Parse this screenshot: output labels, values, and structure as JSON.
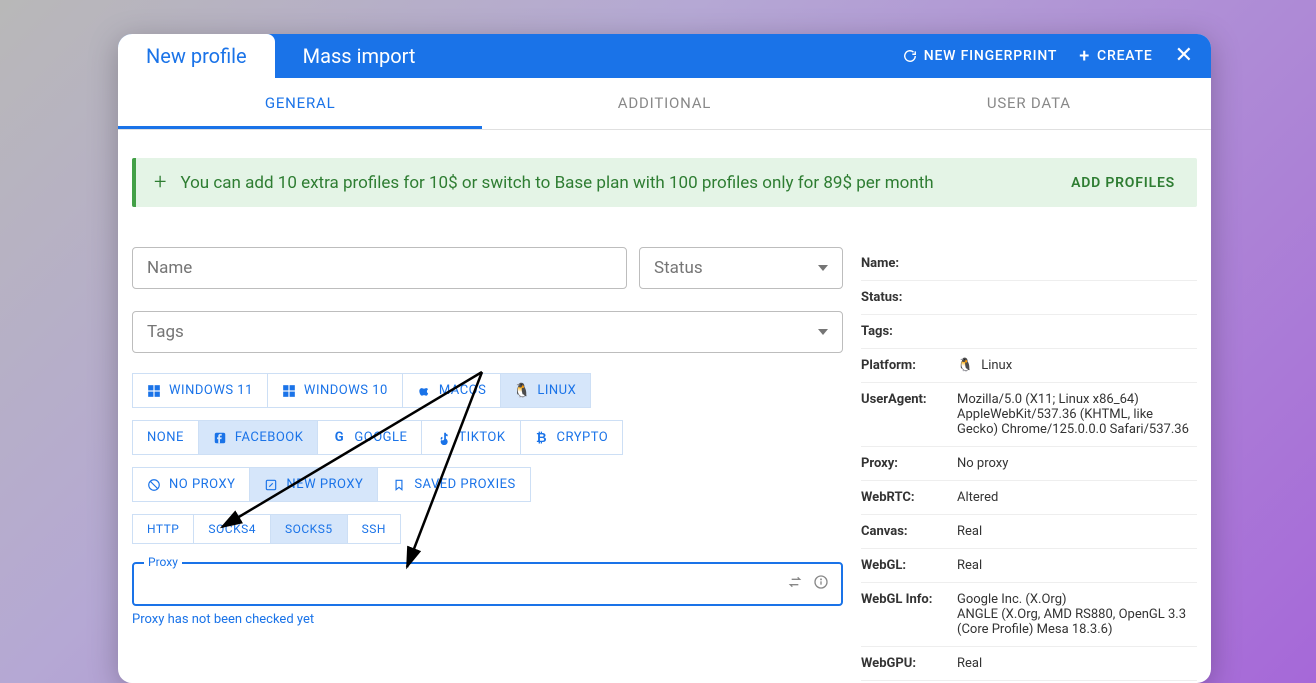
{
  "topbar": {
    "tabs": [
      {
        "label": "New profile",
        "active": true
      },
      {
        "label": "Mass import",
        "active": false
      }
    ],
    "new_fingerprint": "NEW FINGERPRINT",
    "create": "CREATE"
  },
  "subtabs": [
    {
      "label": "GENERAL",
      "active": true
    },
    {
      "label": "ADDITIONAL",
      "active": false
    },
    {
      "label": "USER DATA",
      "active": false
    }
  ],
  "banner": {
    "text": "You can add 10 extra profiles for 10$ or switch to Base plan with 100 profiles only for 89$ per month",
    "action": "ADD PROFILES"
  },
  "form": {
    "name_placeholder": "Name",
    "status_placeholder": "Status",
    "tags_placeholder": "Tags"
  },
  "os_chips": [
    {
      "label": "WINDOWS 11",
      "icon": "windows",
      "active": false
    },
    {
      "label": "WINDOWS 10",
      "icon": "windows",
      "active": false
    },
    {
      "label": "MACOS",
      "icon": "apple",
      "active": false
    },
    {
      "label": "LINUX",
      "icon": "linux",
      "active": true
    }
  ],
  "site_chips": [
    {
      "label": "NONE",
      "icon": "",
      "active": false
    },
    {
      "label": "FACEBOOK",
      "icon": "facebook",
      "active": true
    },
    {
      "label": "GOOGLE",
      "icon": "google",
      "active": false
    },
    {
      "label": "TIKTOK",
      "icon": "tiktok",
      "active": false
    },
    {
      "label": "CRYPTO",
      "icon": "crypto",
      "active": false
    }
  ],
  "proxy_mode_chips": [
    {
      "label": "NO PROXY",
      "icon": "noproxy",
      "active": false
    },
    {
      "label": "NEW PROXY",
      "icon": "edit",
      "active": true
    },
    {
      "label": "SAVED PROXIES",
      "icon": "bookmark",
      "active": false
    }
  ],
  "proto_chips": [
    {
      "label": "HTTP",
      "active": false
    },
    {
      "label": "SOCKS4",
      "active": false
    },
    {
      "label": "SOCKS5",
      "active": true
    },
    {
      "label": "SSH",
      "active": false
    }
  ],
  "proxy": {
    "label": "Proxy",
    "hint": "Proxy has not been checked yet"
  },
  "info": {
    "rows": [
      {
        "label": "Name:",
        "value": ""
      },
      {
        "label": "Status:",
        "value": ""
      },
      {
        "label": "Tags:",
        "value": ""
      },
      {
        "label": "Platform:",
        "value": "Linux",
        "icon": "linux"
      },
      {
        "label": "UserAgent:",
        "value": "Mozilla/5.0 (X11; Linux x86_64) AppleWebKit/537.36 (KHTML, like Gecko) Chrome/125.0.0.0 Safari/537.36"
      },
      {
        "label": "Proxy:",
        "value": "No proxy"
      },
      {
        "label": "WebRTC:",
        "value": "Altered"
      },
      {
        "label": "Canvas:",
        "value": "Real"
      },
      {
        "label": "WebGL:",
        "value": "Real"
      },
      {
        "label": "WebGL Info:",
        "value": "Google Inc. (X.Org)\nANGLE (X.Org, AMD RS880, OpenGL 3.3 (Core Profile) Mesa 18.3.6)"
      },
      {
        "label": "WebGPU:",
        "value": "Real"
      }
    ]
  }
}
